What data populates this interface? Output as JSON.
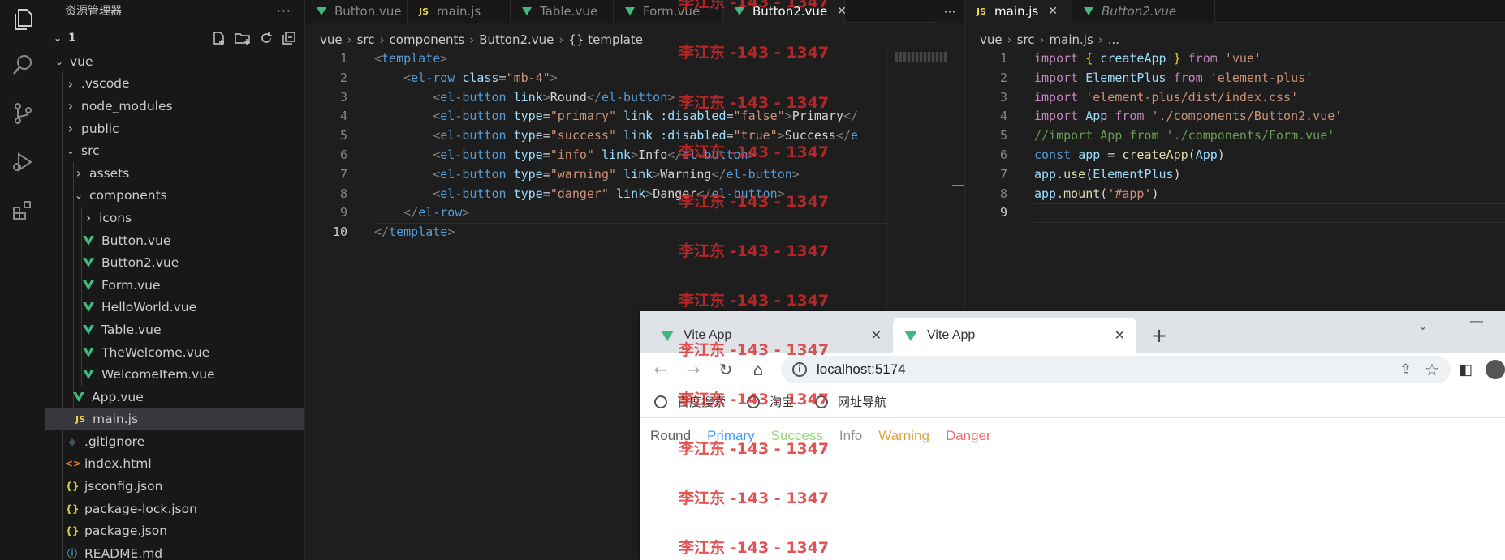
{
  "explorer": {
    "title": "资源管理器",
    "more": "···",
    "root": "1",
    "items": [
      {
        "label": "vue",
        "depth": 1,
        "kind": "folder-open"
      },
      {
        "label": ".vscode",
        "depth": 2,
        "kind": "folder"
      },
      {
        "label": "node_modules",
        "depth": 2,
        "kind": "folder"
      },
      {
        "label": "public",
        "depth": 2,
        "kind": "folder"
      },
      {
        "label": "src",
        "depth": 2,
        "kind": "folder-open"
      },
      {
        "label": "assets",
        "depth": 3,
        "kind": "folder"
      },
      {
        "label": "components",
        "depth": 3,
        "kind": "folder-open"
      },
      {
        "label": "icons",
        "depth": 4,
        "kind": "folder"
      },
      {
        "label": "Button.vue",
        "depth": 4,
        "kind": "vue"
      },
      {
        "label": "Button2.vue",
        "depth": 4,
        "kind": "vue"
      },
      {
        "label": "Form.vue",
        "depth": 4,
        "kind": "vue"
      },
      {
        "label": "HelloWorld.vue",
        "depth": 4,
        "kind": "vue"
      },
      {
        "label": "Table.vue",
        "depth": 4,
        "kind": "vue"
      },
      {
        "label": "TheWelcome.vue",
        "depth": 4,
        "kind": "vue"
      },
      {
        "label": "WelcomeItem.vue",
        "depth": 4,
        "kind": "vue"
      },
      {
        "label": "App.vue",
        "depth": 3,
        "kind": "vue"
      },
      {
        "label": "main.js",
        "depth": 3,
        "kind": "js",
        "selected": true
      },
      {
        "label": ".gitignore",
        "depth": 2,
        "kind": "git"
      },
      {
        "label": "index.html",
        "depth": 2,
        "kind": "html"
      },
      {
        "label": "jsconfig.json",
        "depth": 2,
        "kind": "json"
      },
      {
        "label": "package-lock.json",
        "depth": 2,
        "kind": "json"
      },
      {
        "label": "package.json",
        "depth": 2,
        "kind": "json"
      },
      {
        "label": "README.md",
        "depth": 2,
        "kind": "info"
      }
    ]
  },
  "editor1": {
    "tabs": [
      {
        "label": "Button.vue",
        "type": "vue"
      },
      {
        "label": "main.js",
        "type": "js"
      },
      {
        "label": "Table.vue",
        "type": "vue"
      },
      {
        "label": "Form.vue",
        "type": "vue"
      },
      {
        "label": "Button2.vue",
        "type": "vue",
        "active": true,
        "close": "✕"
      }
    ],
    "more": "···",
    "breadcrumb": [
      "vue",
      "src",
      "components",
      "Button2.vue",
      "{} template"
    ],
    "line_numbers": [
      "1",
      "2",
      "3",
      "4",
      "5",
      "6",
      "7",
      "8",
      "9",
      "10"
    ],
    "current_line": "10",
    "lines": [
      [
        [
          "t-tag",
          "<"
        ],
        [
          "t-name",
          "template"
        ],
        [
          "t-tag",
          ">"
        ]
      ],
      [
        [
          "t-txt",
          "    "
        ],
        [
          "t-tag",
          "<"
        ],
        [
          "t-name",
          "el-row"
        ],
        [
          "t-txt",
          " "
        ],
        [
          "t-attr",
          "class"
        ],
        [
          "t-txt",
          "="
        ],
        [
          "t-str",
          "\"mb-4\""
        ],
        [
          "t-tag",
          ">"
        ]
      ],
      [
        [
          "t-txt",
          "        "
        ],
        [
          "t-tag",
          "<"
        ],
        [
          "t-name",
          "el-button"
        ],
        [
          "t-txt",
          " "
        ],
        [
          "t-attr",
          "link"
        ],
        [
          "t-tag",
          ">"
        ],
        [
          "t-txt",
          "Round"
        ],
        [
          "t-tag",
          "</"
        ],
        [
          "t-name",
          "el-button"
        ],
        [
          "t-tag",
          ">"
        ]
      ],
      [
        [
          "t-txt",
          "        "
        ],
        [
          "t-tag",
          "<"
        ],
        [
          "t-name",
          "el-button"
        ],
        [
          "t-txt",
          " "
        ],
        [
          "t-attr",
          "type"
        ],
        [
          "t-txt",
          "="
        ],
        [
          "t-str",
          "\"primary\""
        ],
        [
          "t-txt",
          " "
        ],
        [
          "t-attr",
          "link"
        ],
        [
          "t-txt",
          " "
        ],
        [
          "t-attr",
          ":disabled"
        ],
        [
          "t-txt",
          "="
        ],
        [
          "t-str",
          "\"false\""
        ],
        [
          "t-tag",
          ">"
        ],
        [
          "t-txt",
          "Primary"
        ],
        [
          "t-tag",
          "</"
        ]
      ],
      [
        [
          "t-txt",
          "        "
        ],
        [
          "t-tag",
          "<"
        ],
        [
          "t-name",
          "el-button"
        ],
        [
          "t-txt",
          " "
        ],
        [
          "t-attr",
          "type"
        ],
        [
          "t-txt",
          "="
        ],
        [
          "t-str",
          "\"success\""
        ],
        [
          "t-txt",
          " "
        ],
        [
          "t-attr",
          "link"
        ],
        [
          "t-txt",
          " "
        ],
        [
          "t-attr",
          ":disabled"
        ],
        [
          "t-txt",
          "="
        ],
        [
          "t-str",
          "\"true\""
        ],
        [
          "t-tag",
          ">"
        ],
        [
          "t-txt",
          "Success"
        ],
        [
          "t-tag",
          "</"
        ],
        [
          "t-name",
          "e"
        ]
      ],
      [
        [
          "t-txt",
          "        "
        ],
        [
          "t-tag",
          "<"
        ],
        [
          "t-name",
          "el-button"
        ],
        [
          "t-txt",
          " "
        ],
        [
          "t-attr",
          "type"
        ],
        [
          "t-txt",
          "="
        ],
        [
          "t-str",
          "\"info\""
        ],
        [
          "t-txt",
          " "
        ],
        [
          "t-attr",
          "link"
        ],
        [
          "t-tag",
          ">"
        ],
        [
          "t-txt",
          "Info"
        ],
        [
          "t-tag",
          "</"
        ],
        [
          "t-name",
          "el-button"
        ],
        [
          "t-tag",
          ">"
        ]
      ],
      [
        [
          "t-txt",
          "        "
        ],
        [
          "t-tag",
          "<"
        ],
        [
          "t-name",
          "el-button"
        ],
        [
          "t-txt",
          " "
        ],
        [
          "t-attr",
          "type"
        ],
        [
          "t-txt",
          "="
        ],
        [
          "t-str",
          "\"warning\""
        ],
        [
          "t-txt",
          " "
        ],
        [
          "t-attr",
          "link"
        ],
        [
          "t-tag",
          ">"
        ],
        [
          "t-txt",
          "Warning"
        ],
        [
          "t-tag",
          "</"
        ],
        [
          "t-name",
          "el-button"
        ],
        [
          "t-tag",
          ">"
        ]
      ],
      [
        [
          "t-txt",
          "        "
        ],
        [
          "t-tag",
          "<"
        ],
        [
          "t-name",
          "el-button"
        ],
        [
          "t-txt",
          " "
        ],
        [
          "t-attr",
          "type"
        ],
        [
          "t-txt",
          "="
        ],
        [
          "t-str",
          "\"danger\""
        ],
        [
          "t-txt",
          " "
        ],
        [
          "t-attr",
          "link"
        ],
        [
          "t-tag",
          ">"
        ],
        [
          "t-txt",
          "Danger"
        ],
        [
          "t-tag",
          "</"
        ],
        [
          "t-name",
          "el-button"
        ],
        [
          "t-tag",
          ">"
        ]
      ],
      [
        [
          "t-txt",
          "    "
        ],
        [
          "t-tag",
          "</"
        ],
        [
          "t-name",
          "el-row"
        ],
        [
          "t-tag",
          ">"
        ]
      ],
      [
        [
          "t-tag",
          "</"
        ],
        [
          "t-name",
          "template"
        ],
        [
          "t-tag",
          ">"
        ]
      ]
    ]
  },
  "editor2": {
    "tabs": [
      {
        "label": "main.js",
        "type": "js",
        "active": true,
        "close": "✕"
      },
      {
        "label": "Button2.vue",
        "type": "vue"
      }
    ],
    "breadcrumb": [
      "vue",
      "src",
      "main.js",
      "..."
    ],
    "line_numbers": [
      "1",
      "2",
      "3",
      "4",
      "5",
      "6",
      "7",
      "8",
      "9"
    ],
    "current_line": "9",
    "lines": [
      [
        [
          "t-kw",
          "import"
        ],
        [
          "t-txt",
          " "
        ],
        [
          "t-brk",
          "{"
        ],
        [
          "t-txt",
          " "
        ],
        [
          "t-var",
          "createApp"
        ],
        [
          "t-txt",
          " "
        ],
        [
          "t-brk",
          "}"
        ],
        [
          "t-txt",
          " "
        ],
        [
          "t-kw",
          "from"
        ],
        [
          "t-txt",
          " "
        ],
        [
          "t-str",
          "'vue'"
        ]
      ],
      [
        [
          "t-kw",
          "import"
        ],
        [
          "t-txt",
          " "
        ],
        [
          "t-var",
          "ElementPlus"
        ],
        [
          "t-txt",
          " "
        ],
        [
          "t-kw",
          "from"
        ],
        [
          "t-txt",
          " "
        ],
        [
          "t-str",
          "'element-plus'"
        ]
      ],
      [
        [
          "t-kw",
          "import"
        ],
        [
          "t-txt",
          " "
        ],
        [
          "t-str",
          "'element-plus/dist/index.css'"
        ]
      ],
      [
        [
          "t-kw",
          "import"
        ],
        [
          "t-txt",
          " "
        ],
        [
          "t-var",
          "App"
        ],
        [
          "t-txt",
          " "
        ],
        [
          "t-kw",
          "from"
        ],
        [
          "t-txt",
          " "
        ],
        [
          "t-str",
          "'./components/Button2.vue'"
        ]
      ],
      [
        [
          "t-cm",
          "//import App from './components/Form.vue'"
        ]
      ],
      [
        [
          "t-kw2",
          "const"
        ],
        [
          "t-txt",
          " "
        ],
        [
          "t-var",
          "app"
        ],
        [
          "t-txt",
          " = "
        ],
        [
          "t-fn",
          "createApp"
        ],
        [
          "t-txt",
          "("
        ],
        [
          "t-var",
          "App"
        ],
        [
          "t-txt",
          ")"
        ]
      ],
      [
        [
          "t-var",
          "app"
        ],
        [
          "t-txt",
          "."
        ],
        [
          "t-fn",
          "use"
        ],
        [
          "t-txt",
          "("
        ],
        [
          "t-var",
          "ElementPlus"
        ],
        [
          "t-txt",
          ")"
        ]
      ],
      [
        [
          "t-var",
          "app"
        ],
        [
          "t-txt",
          "."
        ],
        [
          "t-fn",
          "mount"
        ],
        [
          "t-txt",
          "("
        ],
        [
          "t-str",
          "'#app'"
        ],
        [
          "t-txt",
          ")"
        ]
      ],
      [
        [
          "t-txt",
          ""
        ]
      ]
    ]
  },
  "browser": {
    "tabs": [
      {
        "label": "Vite App",
        "close": "✕"
      },
      {
        "label": "Vite App",
        "close": "✕",
        "active": true
      }
    ],
    "new_tab": "+",
    "url": "localhost:5174",
    "bookmarks": [
      "百度搜索",
      "淘宝",
      "网址导航"
    ],
    "buttons": [
      {
        "label": "Round",
        "color": "#606266"
      },
      {
        "label": "Primary",
        "color": "#409eff"
      },
      {
        "label": "Success",
        "color": "#95d475"
      },
      {
        "label": "Info",
        "color": "#909399"
      },
      {
        "label": "Warning",
        "color": "#e6a23c"
      },
      {
        "label": "Danger",
        "color": "#f56c6c"
      }
    ]
  },
  "watermark": "李江东 -143 - 1347"
}
